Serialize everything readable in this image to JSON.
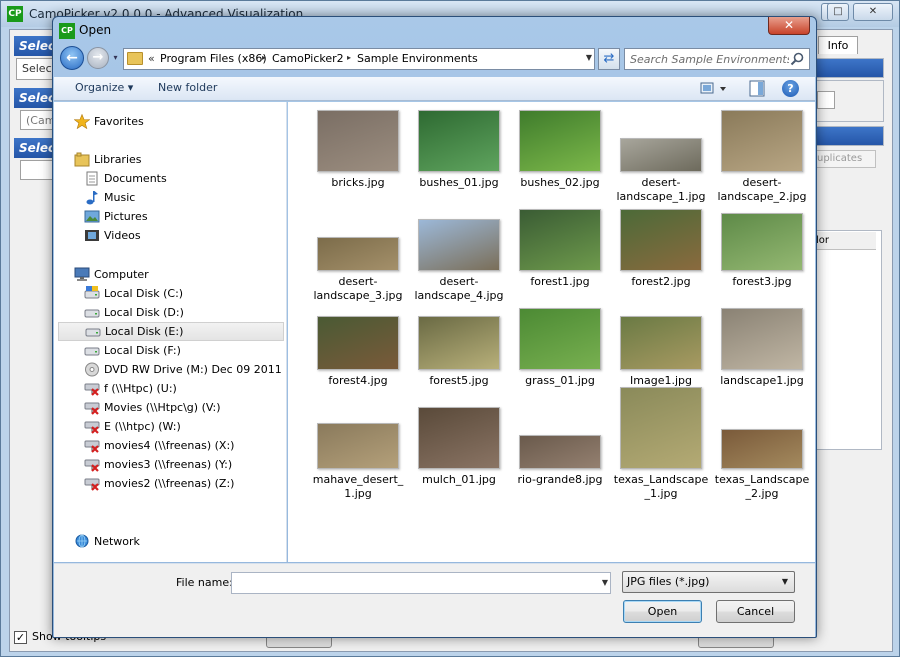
{
  "background_app": {
    "title": "CamoPicker  v2.0.0.0 - Advanced Visualization",
    "app_icon_text": "CP",
    "groups": [
      "Selec",
      "Selec",
      "Selec"
    ],
    "select_button": "Selecte",
    "combo_text": "(Camo",
    "tab_info": "Info",
    "duplicates_select": "uplicates",
    "column_header": "lor",
    "show_tooltips_label": "Show tooltips",
    "show_tooltips_checked": true,
    "window_buttons": {
      "minimize": "—",
      "maximize": "□",
      "close": "✕"
    }
  },
  "dialog": {
    "title": "Open",
    "app_icon_text": "CP",
    "close_glyph": "✕",
    "nav": {
      "back_glyph": "←",
      "forward_glyph": "→",
      "history_glyph": "▾",
      "refresh_glyph": "⇄"
    },
    "address": {
      "chevron": "«",
      "crumbs": [
        "Program Files (x86)",
        "CamoPicker2",
        "Sample Environments"
      ],
      "sep": "▸",
      "dropdown": "▼"
    },
    "search_placeholder": "Search Sample Environments",
    "toolbar": {
      "organize": "Organize ▾",
      "new_folder": "New folder",
      "help_glyph": "?"
    },
    "nav_pane": {
      "favorites": "Favorites",
      "libraries": "Libraries",
      "library_items": [
        "Documents",
        "Music",
        "Pictures",
        "Videos"
      ],
      "computer": "Computer",
      "drives": [
        "Local Disk (C:)",
        "Local Disk (D:)",
        "Local Disk (E:)",
        "Local Disk (F:)",
        "DVD RW Drive (M:) Dec 09 2011",
        "f (\\\\Htpc) (U:)",
        "Movies (\\\\Htpc\\g) (V:)",
        "E (\\\\htpc) (W:)",
        "movies4 (\\\\freenas) (X:)",
        "movies3 (\\\\freenas) (Y:)",
        "movies2 (\\\\freenas) (Z:)"
      ],
      "selected_drive": "Local Disk (E:)",
      "network": "Network"
    },
    "files": [
      {
        "name": "bricks.jpg",
        "colors": [
          "#7a6e64",
          "#9c8e80"
        ]
      },
      {
        "name": "bushes_01.jpg",
        "colors": [
          "#2e6a32",
          "#5fa45e"
        ]
      },
      {
        "name": "bushes_02.jpg",
        "colors": [
          "#3f7c2c",
          "#7cb84a"
        ]
      },
      {
        "name": "desert-landscape_1.jpg",
        "colors": [
          "#a8a69c",
          "#6d6a5c"
        ]
      },
      {
        "name": "desert-landscape_2.jpg",
        "colors": [
          "#8a7a5a",
          "#b8a684"
        ]
      },
      {
        "name": "desert-landscape_3.jpg",
        "colors": [
          "#7c6c4a",
          "#a4906a"
        ]
      },
      {
        "name": "desert-landscape_4.jpg",
        "colors": [
          "#9cb8d8",
          "#7a6e58"
        ]
      },
      {
        "name": "forest1.jpg",
        "colors": [
          "#3a5c34",
          "#6e9a4c"
        ]
      },
      {
        "name": "forest2.jpg",
        "colors": [
          "#4c6a38",
          "#8a6a3e"
        ]
      },
      {
        "name": "forest3.jpg",
        "colors": [
          "#5e8a48",
          "#94b872"
        ]
      },
      {
        "name": "forest4.jpg",
        "colors": [
          "#4a5a34",
          "#7a5a3a"
        ]
      },
      {
        "name": "forest5.jpg",
        "colors": [
          "#6a6a44",
          "#b8b07a"
        ]
      },
      {
        "name": "grass_01.jpg",
        "colors": [
          "#4c8a34",
          "#78b050"
        ]
      },
      {
        "name": "Image1.jpg",
        "colors": [
          "#6a7a44",
          "#a89a62"
        ]
      },
      {
        "name": "landscape1.jpg",
        "colors": [
          "#8a8274",
          "#c0b6a4"
        ]
      },
      {
        "name": "mahave_desert_1.jpg",
        "colors": [
          "#8a7a5c",
          "#b4a07a"
        ]
      },
      {
        "name": "mulch_01.jpg",
        "colors": [
          "#5a4a3a",
          "#8a7464"
        ]
      },
      {
        "name": "rio-grande8.jpg",
        "colors": [
          "#6a5a4c",
          "#948070"
        ]
      },
      {
        "name": "texas_Landscape_1.jpg",
        "colors": [
          "#8a8a5a",
          "#b4aa74"
        ]
      },
      {
        "name": "texas_Landscape_2.jpg",
        "colors": [
          "#7a5a3a",
          "#a48a5e"
        ]
      }
    ],
    "filename_label": "File name:",
    "filename_value": "",
    "filetype": "JPG files (*.jpg)",
    "open_label": "Open",
    "cancel_label": "Cancel"
  }
}
